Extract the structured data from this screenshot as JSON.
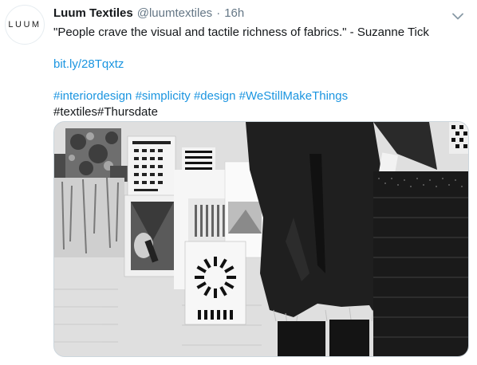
{
  "tweet": {
    "avatar_text": "LUUM",
    "name": "Luum Textiles",
    "handle": "@luumtextiles",
    "separator": "·",
    "time": "16h",
    "text": "\"People crave the visual and tactile richness of fabrics.\" - Suzanne Tick",
    "link": "bit.ly/28Tqxtz",
    "hashtags_line1": [
      "#interiordesign",
      "#simplicity",
      "#design",
      "#WeStillMakeThings"
    ],
    "hashtags_line2": "#textiles#Thursdate"
  },
  "colors": {
    "link": "#1b95e0",
    "muted": "#657786",
    "text": "#14171a"
  },
  "icons": {
    "menu": "chevron-down-icon"
  }
}
